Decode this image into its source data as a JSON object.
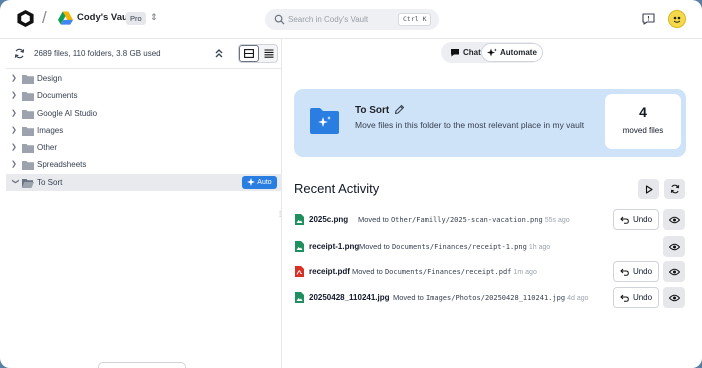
{
  "header": {
    "vault_name": "Cody's Vault",
    "plan_badge": "Pro",
    "search_placeholder": "Search in Cody's Vault",
    "search_shortcut": "Ctrl K"
  },
  "sidebar": {
    "stats": "2689 files, 110 folders, 3.8 GB used",
    "folders": [
      {
        "label": "Design"
      },
      {
        "label": "Documents"
      },
      {
        "label": "Google AI Studio"
      },
      {
        "label": "Images"
      },
      {
        "label": "Other"
      },
      {
        "label": "Spreadsheets"
      },
      {
        "label": "To Sort",
        "selected": true,
        "badge": "Auto"
      }
    ]
  },
  "modes": {
    "chat_label": "Chat",
    "automate_label": "Automate",
    "active": "Automate"
  },
  "banner": {
    "title": "To Sort",
    "description": "Move files in this folder to the most relevant place in my vault",
    "moved_count": "4",
    "moved_label": "moved files"
  },
  "activity": {
    "title": "Recent Activity",
    "undo_label": "Undo",
    "items": [
      {
        "file": "2025c.png",
        "prefix": "Moved to",
        "path": "Other/Familly/2025-scan-vacation.png",
        "ago": "55s ago",
        "type": "image",
        "has_undo": true
      },
      {
        "file": "receipt-1.png",
        "prefix": "Moved to",
        "path": "Documents/Finances/receipt-1.png",
        "ago": "1h ago",
        "type": "image",
        "has_undo": false
      },
      {
        "file": "receipt.pdf",
        "prefix": "Moved to",
        "path": "Documents/Finances/receipt.pdf",
        "ago": "1m ago",
        "type": "pdf",
        "has_undo": true
      },
      {
        "file": "20250428_110241.jpg",
        "prefix": "Moved to",
        "path": "Images/Photos/20250428_110241.jpg",
        "ago": "4d ago",
        "type": "image",
        "has_undo": true
      }
    ]
  },
  "colors": {
    "accent": "#2a7de1",
    "banner_bg": "#cfe3f8",
    "image_file": "#1f8f5f",
    "pdf_file": "#d93025"
  }
}
